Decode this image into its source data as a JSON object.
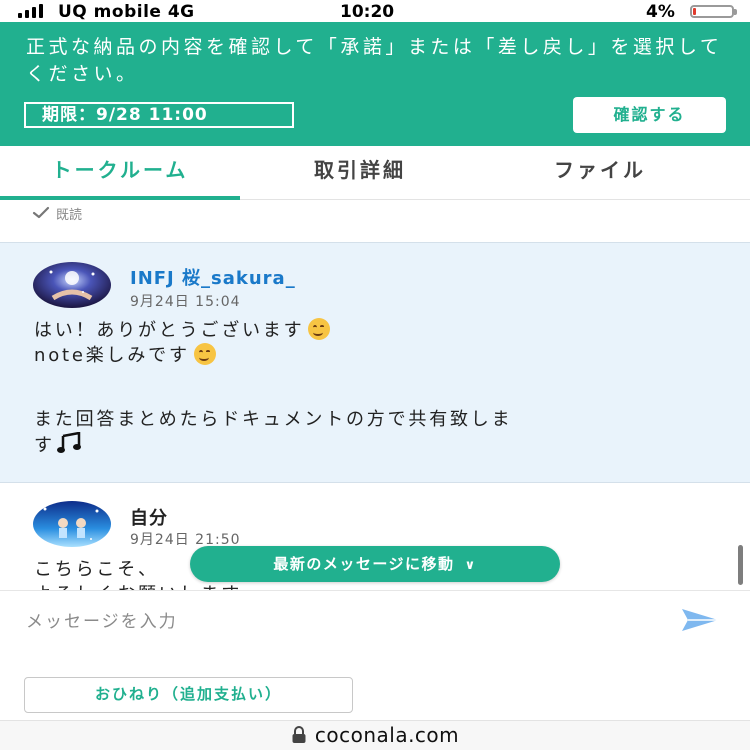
{
  "status_bar": {
    "carrier": "UQ mobile  4G",
    "time": "10:20",
    "battery": "4%"
  },
  "banner": {
    "message": "正式な納品の内容を確認して「承諾」または「差し戻し」を選択してください。",
    "deadline": "期限：9/28 11:00",
    "confirm_button": "確認する",
    "color": "#21b08f"
  },
  "tabs": [
    {
      "label": "トークルーム",
      "active": true
    },
    {
      "label": "取引詳細",
      "active": false
    },
    {
      "label": "ファイル",
      "active": false
    }
  ],
  "read_receipt": "既読",
  "messages": [
    {
      "sender": "INFJ 桜_sakura_",
      "time": "9月24日 15:04",
      "lines": [
        "はい！ありがとうございます",
        "note楽しみです",
        "",
        "また回答まとめたらドキュメントの方で共有致しま",
        "す"
      ]
    },
    {
      "sender": "自分",
      "time": "9月24日 21:50",
      "lines": [
        "こちらこそ、",
        "よろしくお願いします"
      ]
    }
  ],
  "jump_button": "最新のメッセージに移動",
  "input": {
    "placeholder": "メッセージを入力"
  },
  "tip_button": "おひねり（追加支払い）",
  "url": "coconala.com"
}
